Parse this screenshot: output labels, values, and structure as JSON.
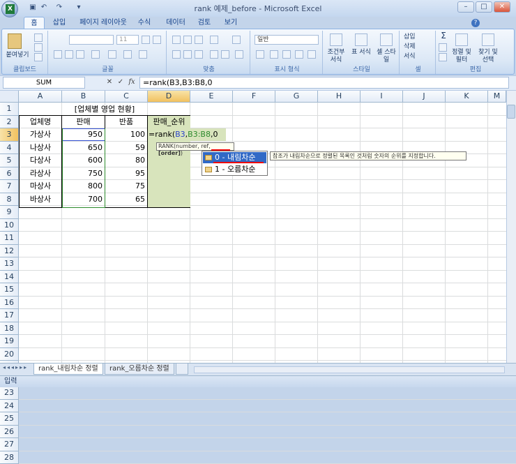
{
  "window": {
    "title": "rank 예제_before - Microsoft Excel"
  },
  "ribbon": {
    "tabs": [
      "홈",
      "삽입",
      "페이지 레이아웃",
      "수식",
      "데이터",
      "검토",
      "보기"
    ],
    "groups": [
      "클립보드",
      "글꼴",
      "맞춤",
      "표시 형식",
      "스타일",
      "셀",
      "편집"
    ],
    "clipboard": {
      "paste": "붙여넣기"
    },
    "font": {
      "name": "",
      "size": "11"
    },
    "number": {
      "format": "일반"
    },
    "styles": [
      "조건부 서식",
      "표 서식",
      "셀 스타일"
    ],
    "cells": [
      "삽입",
      "삭제",
      "서식"
    ],
    "editing": [
      "정렬 및 필터",
      "찾기 및 선택"
    ]
  },
  "formula_bar": {
    "name_box": "SUM",
    "formula": "=rank(B3,B3:B8,0",
    "fx": "fx"
  },
  "columns": [
    "A",
    "B",
    "C",
    "D",
    "E",
    "F",
    "G",
    "H",
    "I",
    "J",
    "K",
    "L",
    "M"
  ],
  "rows": [
    "1",
    "2",
    "3",
    "4",
    "5",
    "6",
    "7",
    "8",
    "9",
    "10",
    "11",
    "12",
    "13",
    "14",
    "15",
    "16",
    "17",
    "18",
    "19",
    "20",
    "21",
    "22",
    "23",
    "24",
    "25",
    "26",
    "27",
    "28"
  ],
  "sheet": {
    "title": "[업체별 영업 현황]",
    "headers": [
      "업체명",
      "판매",
      "반품",
      "판매_순위"
    ],
    "data": [
      [
        "가상사",
        "950",
        "100"
      ],
      [
        "나상사",
        "650",
        "59"
      ],
      [
        "다상사",
        "600",
        "80"
      ],
      [
        "라상사",
        "750",
        "95"
      ],
      [
        "마상사",
        "800",
        "75"
      ],
      [
        "바상사",
        "700",
        "65"
      ]
    ],
    "edit_cell": {
      "p1": "=rank(",
      "p2": "B3",
      "p3": ",",
      "p4": "B3:B8",
      "p5": ",0"
    }
  },
  "tooltip": {
    "p1": "RANK(number, ref, ",
    "p2": "[order]",
    "p3": ")"
  },
  "autocomplete": [
    "0 - 내림차순",
    "1 - 오름차순"
  ],
  "hint": "참조가 내림차순으로 정렬된 목록인 것처럼 숫자의 순위를 지정합니다.",
  "sheet_tabs": [
    "rank_내림차순 정렬",
    "rank_오름차순 정렬"
  ],
  "status": "입력"
}
